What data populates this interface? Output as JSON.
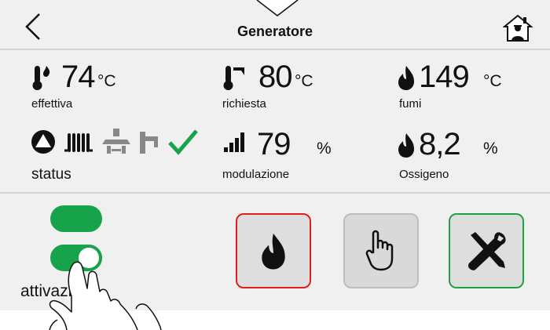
{
  "header": {
    "title": "Generatore",
    "back": "chevron-left-icon",
    "home": "house-icon"
  },
  "metrics": [
    {
      "value": "74",
      "unit": "°C",
      "label": "effettiva",
      "icon": "thermometer-flame-icon"
    },
    {
      "value": "80",
      "unit": "°C",
      "label": "richiesta",
      "icon": "thermometer-setpoint-icon"
    },
    {
      "value": "149",
      "unit": "°C",
      "label": "fumi",
      "icon": "flame-icon"
    }
  ],
  "status": {
    "label": "status",
    "icons": [
      "pump-icon",
      "radiator-icon",
      "heat-exchanger-icon",
      "faucet-icon",
      "checkmark-icon"
    ]
  },
  "modulation": {
    "value": "79",
    "unit": "%",
    "label": "modulazione",
    "icon": "signal-bars-icon"
  },
  "oxygen": {
    "value": "8,2",
    "unit": "%",
    "label": "Ossigeno",
    "icon": "flame-icon"
  },
  "activation": {
    "label": "attivazione",
    "on": true
  },
  "buttons": [
    {
      "name": "flame",
      "icon": "flame-icon"
    },
    {
      "name": "manual",
      "icon": "pointing-hand-icon"
    },
    {
      "name": "tools",
      "icon": "tools-icon"
    }
  ],
  "colors": {
    "green": "#16a34a",
    "red": "#e11d1d",
    "panel": "#f0f0f0"
  }
}
